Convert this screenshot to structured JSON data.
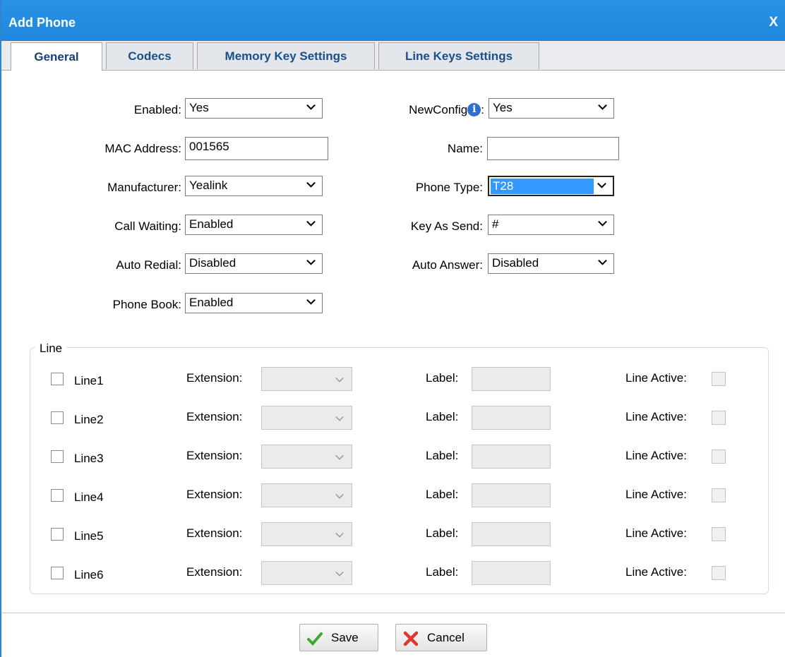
{
  "dialog": {
    "title": "Add Phone",
    "close_label": "X"
  },
  "tabs": [
    {
      "label": "General"
    },
    {
      "label": "Codecs"
    },
    {
      "label": "Memory Key Settings"
    },
    {
      "label": "Line Keys Settings"
    }
  ],
  "form": {
    "enabled": {
      "label": "Enabled:",
      "value": "Yes"
    },
    "mac": {
      "label": "MAC Address:",
      "value": "001565"
    },
    "manufacturer": {
      "label": "Manufacturer:",
      "value": "Yealink"
    },
    "call_waiting": {
      "label": "Call Waiting:",
      "value": "Enabled"
    },
    "auto_redial": {
      "label": "Auto Redial:",
      "value": "Disabled"
    },
    "phone_book": {
      "label": "Phone Book:",
      "value": "Enabled"
    },
    "newconfig": {
      "label": "NewConfig",
      "suffix": ":",
      "value": "Yes",
      "info_glyph": "i"
    },
    "name": {
      "label": "Name:",
      "value": ""
    },
    "phone_type": {
      "label": "Phone Type:",
      "value": "T28"
    },
    "key_as_send": {
      "label": "Key As Send:",
      "value": "#"
    },
    "auto_answer": {
      "label": "Auto Answer:",
      "value": "Disabled"
    }
  },
  "line_section": {
    "legend": "Line",
    "extension_label": "Extension:",
    "label_label": "Label:",
    "line_active_label": "Line Active:",
    "lines": [
      {
        "name": "Line1"
      },
      {
        "name": "Line2"
      },
      {
        "name": "Line3"
      },
      {
        "name": "Line4"
      },
      {
        "name": "Line5"
      },
      {
        "name": "Line6"
      }
    ]
  },
  "footer": {
    "save_label": "Save",
    "cancel_label": "Cancel"
  },
  "colors": {
    "titlebar": "#1e86dc",
    "tab_text": "#1a4f8b",
    "selection": "#3399ff",
    "save_check": "#3aaa35",
    "cancel_x": "#e0372f"
  },
  "icons": {
    "info": "info-icon",
    "chevron": "chevron-down-icon",
    "save": "checkmark-icon",
    "cancel": "x-icon"
  }
}
